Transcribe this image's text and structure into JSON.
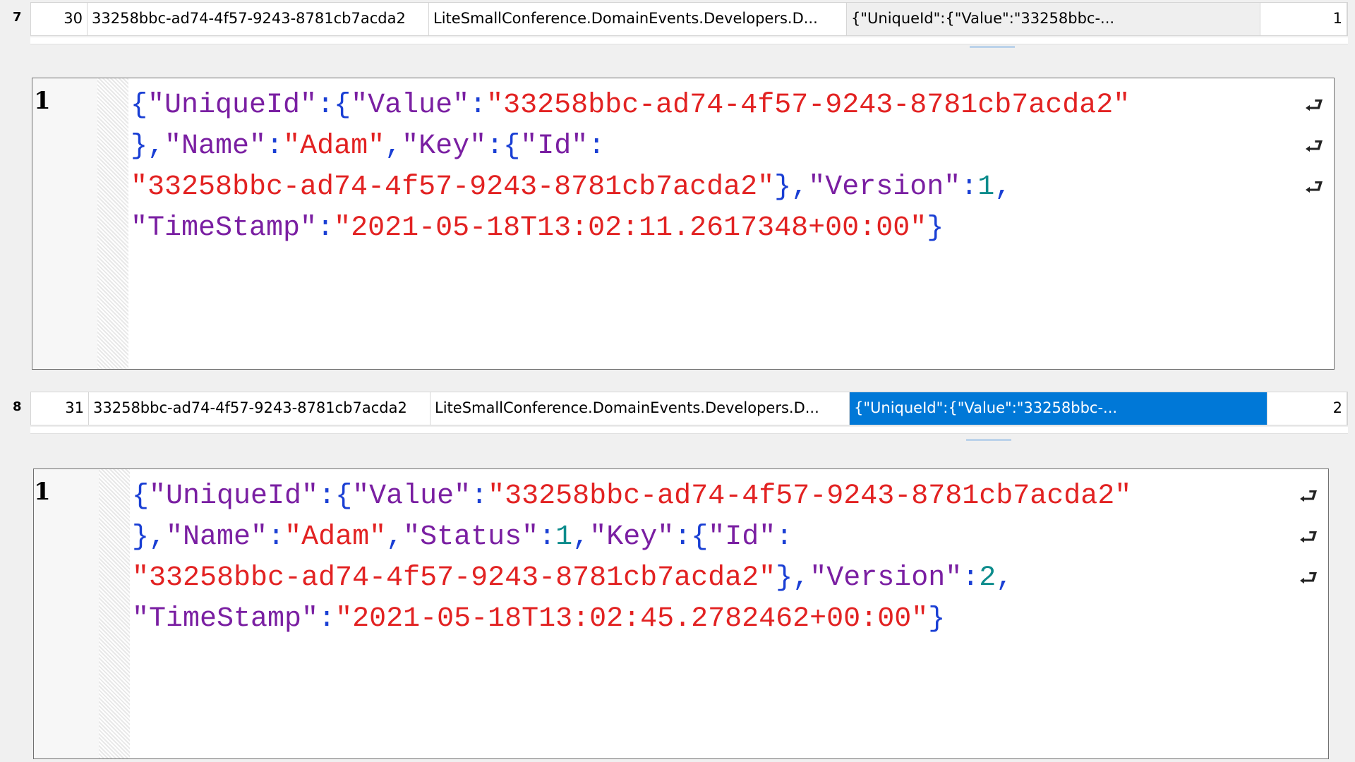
{
  "rows": [
    {
      "row_number": "7",
      "id": "30",
      "aggregate_id": "33258bbc-ad74-4f57-9243-8781cb7acda2",
      "event_type": "LiteSmallConference.DomainEvents.Developers.D...",
      "payload_preview": "{\"UniqueId\":{\"Value\":\"33258bbc-...",
      "version": "1",
      "selected": false
    },
    {
      "row_number": "8",
      "id": "31",
      "aggregate_id": "33258bbc-ad74-4f57-9243-8781cb7acda2",
      "event_type": "LiteSmallConference.DomainEvents.Developers.D...",
      "payload_preview": "{\"UniqueId\":{\"Value\":\"33258bbc-...",
      "version": "2",
      "selected": true
    }
  ],
  "editors": [
    {
      "line_number": "1",
      "lines": [
        [
          [
            "{",
            "p"
          ],
          [
            "\"UniqueId\"",
            "k"
          ],
          [
            ":",
            "p"
          ],
          [
            "{",
            "p"
          ],
          [
            "\"Value\"",
            "k"
          ],
          [
            ":",
            "p"
          ],
          [
            "\"33258bbc-ad74-4f57-9243-8781cb7acda2\"",
            "s"
          ]
        ],
        [
          [
            "}",
            "p"
          ],
          [
            ",",
            "p"
          ],
          [
            "\"Name\"",
            "k"
          ],
          [
            ":",
            "p"
          ],
          [
            "\"Adam\"",
            "s"
          ],
          [
            ",",
            "p"
          ],
          [
            "\"Key\"",
            "k"
          ],
          [
            ":",
            "p"
          ],
          [
            "{",
            "p"
          ],
          [
            "\"Id\"",
            "k"
          ],
          [
            ":",
            "p"
          ]
        ],
        [
          [
            "\"33258bbc-ad74-4f57-9243-8781cb7acda2\"",
            "s"
          ],
          [
            "}",
            "p"
          ],
          [
            ",",
            "p"
          ],
          [
            "\"Version\"",
            "k"
          ],
          [
            ":",
            "p"
          ],
          [
            "1",
            "n"
          ],
          [
            ",",
            "p"
          ]
        ],
        [
          [
            "\"TimeStamp\"",
            "k"
          ],
          [
            ":",
            "p"
          ],
          [
            "\"2021-05-18T13:02:11.2617348+00:00\"",
            "s"
          ],
          [
            "}",
            "p"
          ]
        ]
      ],
      "wrap_markers": 3
    },
    {
      "line_number": "1",
      "lines": [
        [
          [
            "{",
            "p"
          ],
          [
            "\"UniqueId\"",
            "k"
          ],
          [
            ":",
            "p"
          ],
          [
            "{",
            "p"
          ],
          [
            "\"Value\"",
            "k"
          ],
          [
            ":",
            "p"
          ],
          [
            "\"33258bbc-ad74-4f57-9243-8781cb7acda2\"",
            "s"
          ]
        ],
        [
          [
            "}",
            "p"
          ],
          [
            ",",
            "p"
          ],
          [
            "\"Name\"",
            "k"
          ],
          [
            ":",
            "p"
          ],
          [
            "\"Adam\"",
            "s"
          ],
          [
            ",",
            "p"
          ],
          [
            "\"Status\"",
            "k"
          ],
          [
            ":",
            "p"
          ],
          [
            "1",
            "n"
          ],
          [
            ",",
            "p"
          ],
          [
            "\"Key\"",
            "k"
          ],
          [
            ":",
            "p"
          ],
          [
            "{",
            "p"
          ],
          [
            "\"Id\"",
            "k"
          ],
          [
            ":",
            "p"
          ]
        ],
        [
          [
            "\"33258bbc-ad74-4f57-9243-8781cb7acda2\"",
            "s"
          ],
          [
            "}",
            "p"
          ],
          [
            ",",
            "p"
          ],
          [
            "\"Version\"",
            "k"
          ],
          [
            ":",
            "p"
          ],
          [
            "2",
            "n"
          ],
          [
            ",",
            "p"
          ]
        ],
        [
          [
            "\"TimeStamp\"",
            "k"
          ],
          [
            ":",
            "p"
          ],
          [
            "\"2021-05-18T13:02:45.2782462+00:00\"",
            "s"
          ],
          [
            "}",
            "p"
          ]
        ]
      ],
      "wrap_markers": 3
    }
  ],
  "icons": {
    "wrap": "word-wrap-arrow-icon"
  },
  "colors": {
    "selection": "#0078d7",
    "json_key": "#7a1fa2",
    "json_string": "#e22222",
    "json_punctuation": "#1a3fd4",
    "json_number": "#0c8c8c"
  }
}
